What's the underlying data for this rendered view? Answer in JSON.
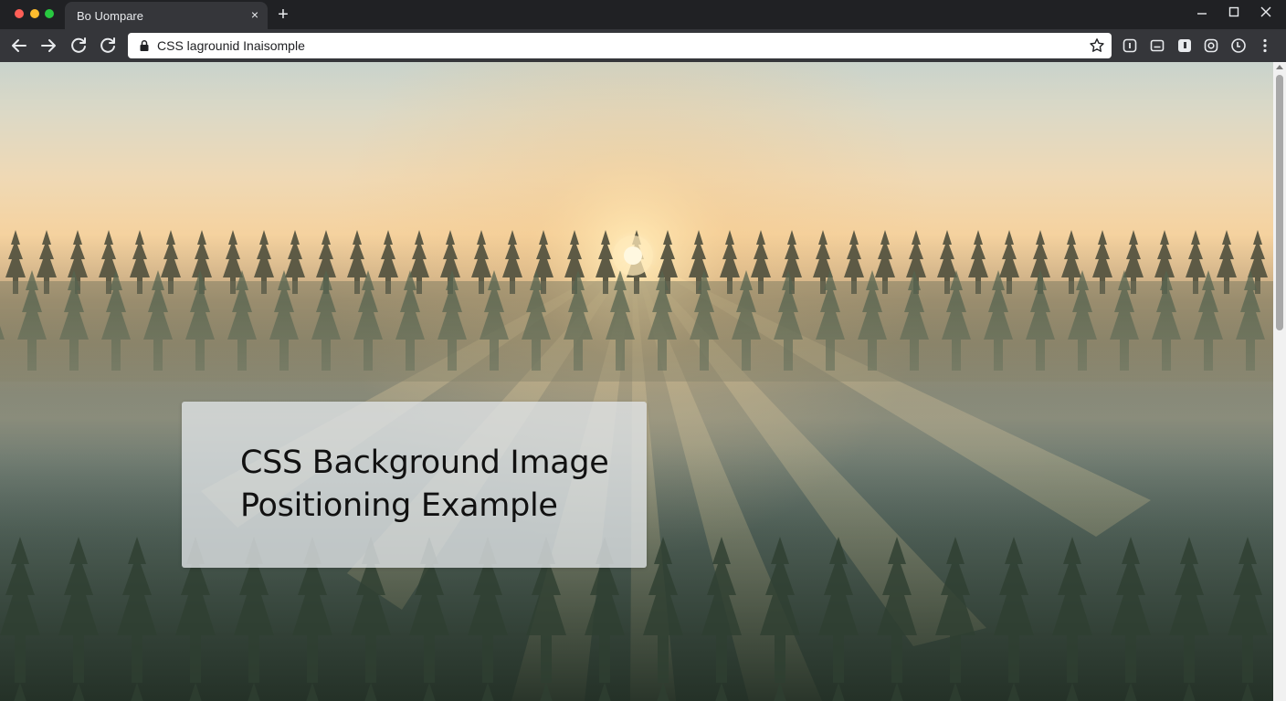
{
  "window": {
    "tab_title": "Bo Uompare",
    "new_tab": "+",
    "tab_close": "×"
  },
  "toolbar": {
    "url": "CSS lagrounid Inaisomple"
  },
  "page": {
    "heading_line1": "CSS Background Image",
    "heading_line2": "Positioning Example"
  },
  "colors": {
    "titlebar": "#202124",
    "toolbar": "#35363a",
    "omnibox": "#ffffff",
    "card": "#dee2e5",
    "sun": "#fff8e0"
  },
  "icons": {
    "nav": [
      "arrow-left-icon",
      "arrow-right-icon",
      "refresh-icon",
      "reload-icon"
    ],
    "omnibox": [
      "lock-icon",
      "star-icon"
    ],
    "extensions": [
      "ext-info-icon",
      "ext-window-icon",
      "ext-shield-icon",
      "ext-target-icon",
      "ext-clock-icon",
      "more-icon"
    ]
  }
}
